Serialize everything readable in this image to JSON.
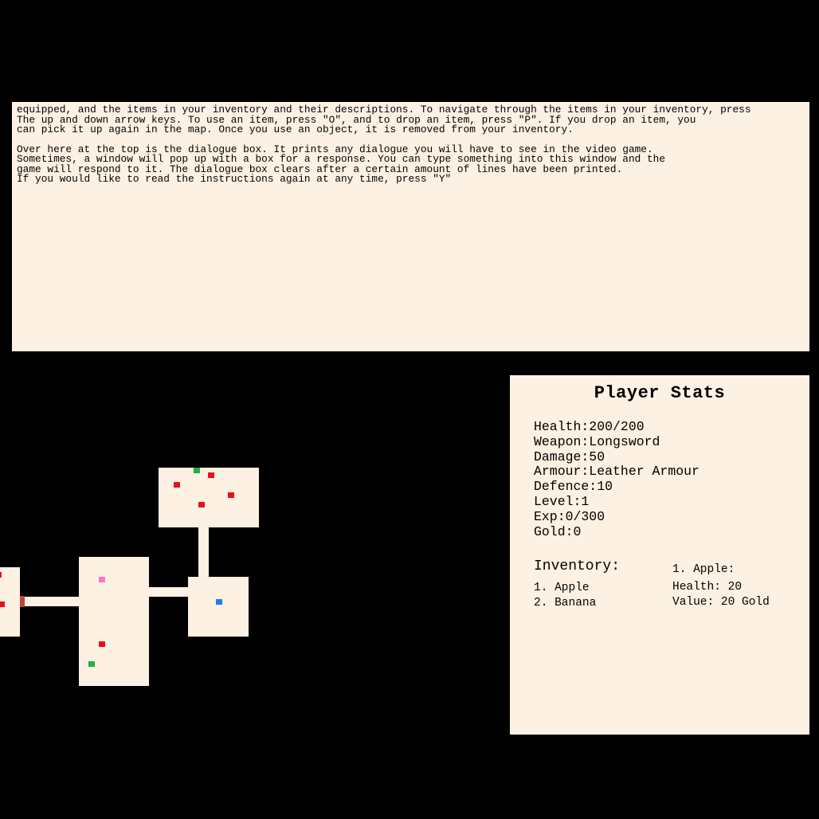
{
  "dialogue": {
    "lines": [
      "equipped, and the items in your inventory and their descriptions. To navigate through the items in your inventory, press",
      "The up and down arrow keys. To use an item, press \"O\", and to drop an item, press \"P\". If you drop an item, you",
      "can pick it up again in the map. Once you use an object, it is removed from your inventory.",
      "",
      "Over here at the top is the dialogue box. It prints any dialogue you will have to see in the video game.",
      "Sometimes, a window will pop up with a box for a response. You can type something into this window and the",
      "game will respond to it. The dialogue box clears after a certain amount of lines have been printed.",
      "If you would like to read the instructions again at any time, press \"Y\""
    ]
  },
  "map": {
    "floor_color": "#fdf1e3",
    "tile_colors": {
      "enemy": "#e8101a",
      "item": "#ff77c8",
      "npc": "#22b23a",
      "player": "#1e7ff0",
      "door": "#b84a38"
    }
  },
  "stats": {
    "title": "Player Stats",
    "health": "Health:200/200",
    "weapon": "Weapon:Longsword",
    "damage": "Damage:50",
    "armour": "Armour:Leather Armour",
    "defence": "Defence:10",
    "level": "Level:1",
    "exp": "Exp:0/300",
    "gold": "Gold:0"
  },
  "inventory": {
    "heading": "Inventory:",
    "items": [
      "1. Apple",
      "2. Banana"
    ],
    "selected": {
      "name": "1. Apple:",
      "health": "Health: 20",
      "value": "Value: 20 Gold"
    }
  }
}
